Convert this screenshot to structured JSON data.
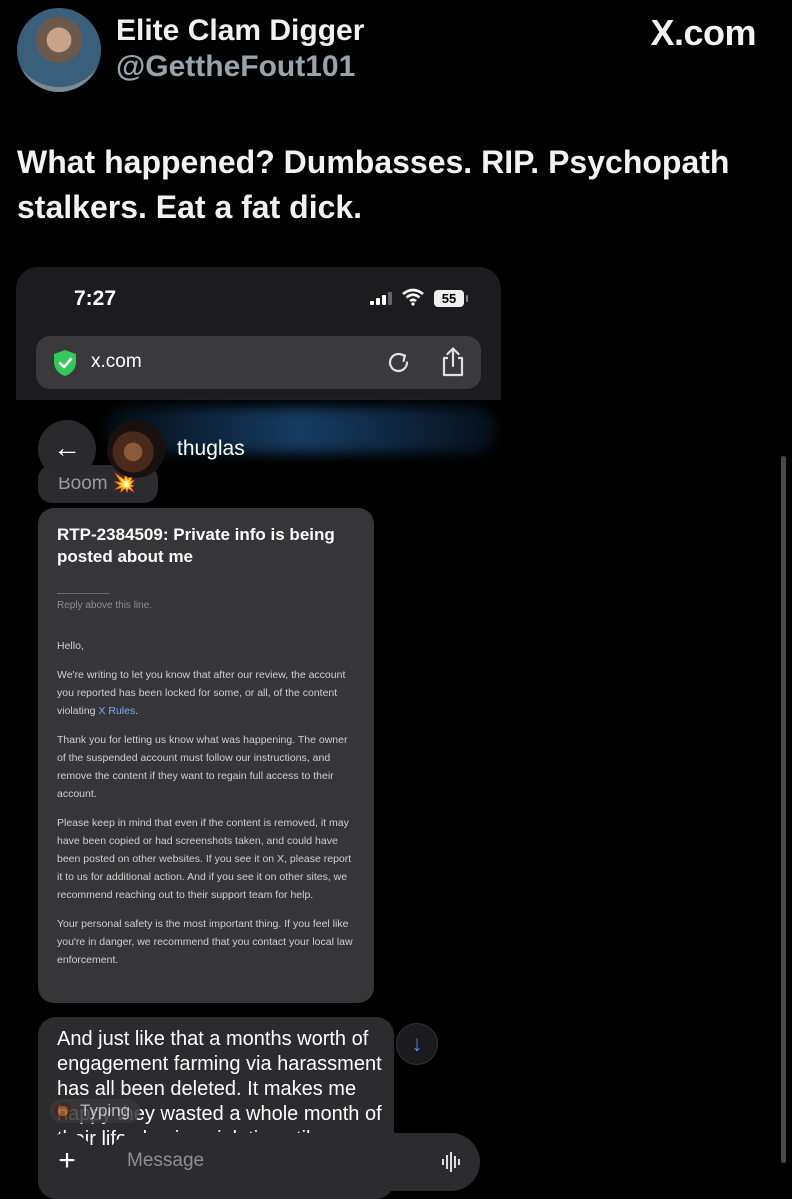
{
  "tweet": {
    "display_name": "Elite Clam Digger",
    "handle": "@GettheFout101",
    "brand": "X.com",
    "text": "What happened? Dumbasses. RIP. Psychopath stalkers. Eat a fat dick."
  },
  "screenshot": {
    "status_bar": {
      "time": "7:27",
      "battery": "55"
    },
    "browser": {
      "url": "x.com"
    },
    "chat": {
      "contact_name": "thuglas",
      "prev_message": "Boom 💥",
      "email": {
        "subject": "RTP-2384509: Private info is being posted about me",
        "reply_line": "Reply above this line.",
        "greeting": "Hello,",
        "p1_before_link": "We're writing to let you know that after our review, the account you reported has been locked for some, or all, of the content violating ",
        "p1_link": "X Rules",
        "p1_after_link": ".",
        "p2": "Thank you for letting us know what was happening. The owner of the suspended account must follow our instructions, and remove the content if they want to regain full access to their account.",
        "p3": "Please keep in mind that even if the content is removed, it may have been copied or had screenshots taken, and could have been posted on other websites. If you see it on X, please report it to us for additional action. And if you see it on other sites, we recommend reaching out to their support team for help.",
        "p4": "Your personal safety is the most important thing. If you feel like you're in danger, we recommend that you contact your local law enforcement."
      },
      "message_text": "And just like that a months worth of engagement farming via harassment has all been deleted. It makes me happy they wasted a whole month of their life chasing violations til",
      "typing_label": "Typing",
      "composer_placeholder": "Message"
    }
  },
  "icons": {
    "back": "arrow-left-icon",
    "plus": "plus-icon",
    "scroll": "arrow-down-icon",
    "voice": "voice-waveform-icon",
    "shield": "shield-check-icon",
    "reload": "reload-icon",
    "share": "share-icon"
  },
  "colors": {
    "link": "#7fa7ff",
    "scroll_arrow": "#4a8cff",
    "shield": "#34c759"
  }
}
